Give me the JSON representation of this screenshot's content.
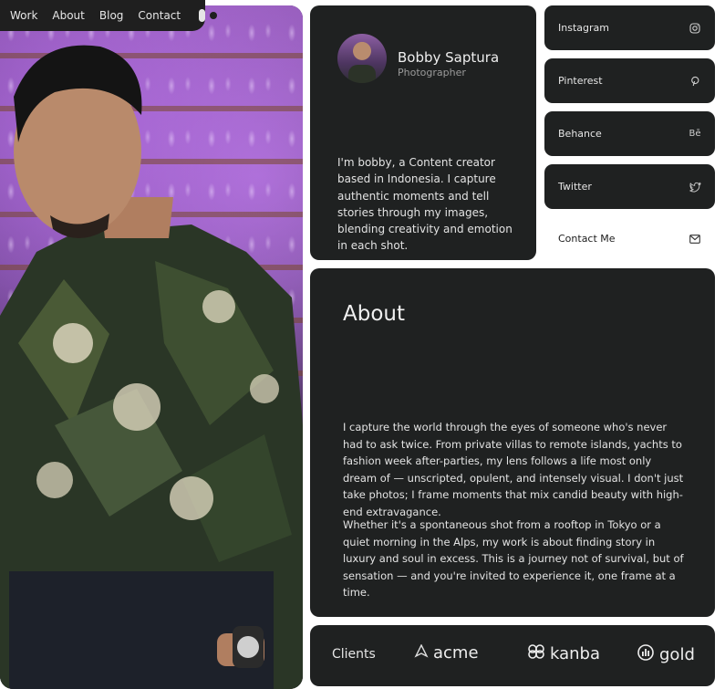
{
  "nav": {
    "items": [
      "Work",
      "About",
      "Blog",
      "Contact"
    ]
  },
  "profile": {
    "name": "Bobby Saptura",
    "role": "Photographer",
    "bio": "I'm bobby, a Content creator based in Indonesia. I capture authentic moments and tell stories through my images, blending creativity and emotion in each shot."
  },
  "social": [
    {
      "label": "Instagram",
      "icon": "instagram-icon"
    },
    {
      "label": "Pinterest",
      "icon": "pinterest-icon"
    },
    {
      "label": "Behance",
      "icon": "behance-icon"
    },
    {
      "label": "Twitter",
      "icon": "twitter-icon"
    },
    {
      "label": "Contact Me",
      "icon": "mail-icon"
    }
  ],
  "about": {
    "title": "About",
    "p1": "I capture the world through the eyes of someone who's never had to ask twice. From private villas to remote islands, yachts to fashion week after-parties, my lens follows a life most only dream of — unscripted, opulent, and intensely visual. I don't just take photos; I frame moments that mix candid beauty with high-end extravagance.",
    "p2": "Whether it's a spontaneous shot from a rooftop in Tokyo or a quiet morning in the Alps, my work is about finding story in luxury and soul in excess. This is a journey not of survival, but of sensation — and you're invited to experience it, one frame at a time."
  },
  "clients": {
    "label": "Clients",
    "logos": [
      {
        "name": "acme",
        "icon": "acme-logo-icon"
      },
      {
        "name": "kanba",
        "icon": "kanba-logo-icon"
      },
      {
        "name": "gold",
        "icon": "gold-logo-icon"
      }
    ]
  },
  "colors": {
    "background": "#ffffff",
    "card": "#1f2121",
    "accent_card": "#ffffff"
  }
}
